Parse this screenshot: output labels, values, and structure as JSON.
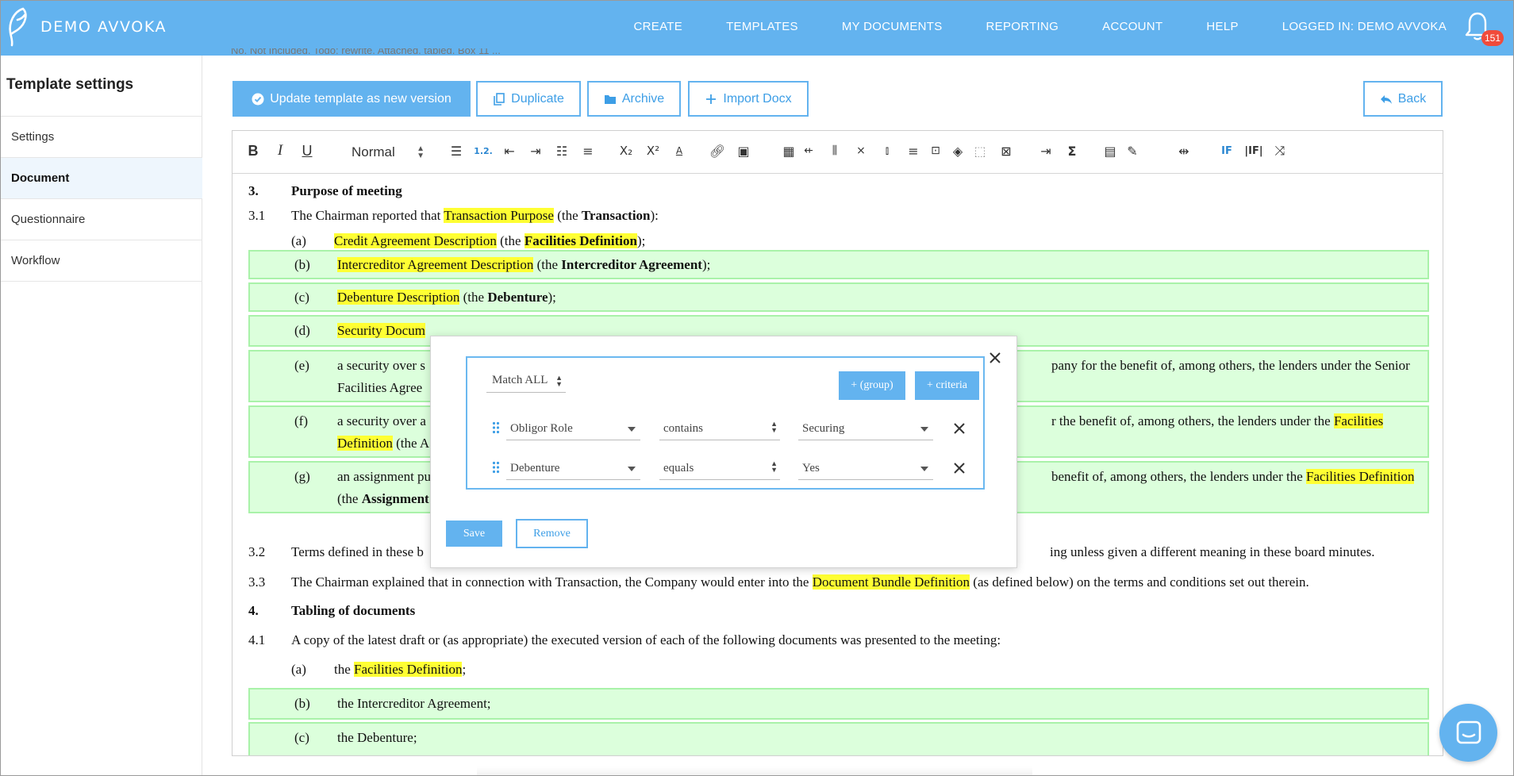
{
  "header": {
    "brand": "DEMO AVVOKA",
    "nav": [
      "CREATE",
      "TEMPLATES",
      "MY DOCUMENTS",
      "REPORTING",
      "ACCOUNT",
      "HELP",
      "LOGGED IN: DEMO AVVOKA"
    ],
    "notification_count": "151",
    "colors": {
      "bar": "#63b3ef",
      "badge": "#f04b3b"
    }
  },
  "sidebar": {
    "title": "Template settings",
    "items": [
      {
        "label": "Settings",
        "active": false
      },
      {
        "label": "Document",
        "active": true
      },
      {
        "label": "Questionnaire",
        "active": false
      },
      {
        "label": "Workflow",
        "active": false
      }
    ]
  },
  "actions": {
    "update": "Update template as new version",
    "duplicate": "Duplicate",
    "archive": "Archive",
    "import": "Import Docx",
    "back": "Back"
  },
  "toolbar": {
    "style_select": "Normal",
    "icons": [
      "bold-icon",
      "italic-icon",
      "underline-icon",
      "bullet-list-icon",
      "numbered-list-icon",
      "outdent-icon",
      "indent-icon",
      "checklist-icon",
      "align-left-icon",
      "subscript-icon",
      "superscript-icon",
      "text-color-icon",
      "link-icon",
      "image-icon",
      "table-icon",
      "insert-column-left-icon",
      "insert-column-right-icon",
      "delete-column-icon",
      "delete-row-icon",
      "align-icon",
      "merge-cells-icon",
      "fill-color-icon",
      "table-borders-icon",
      "crop-icon",
      "field-icon",
      "sum-icon",
      "calendar-icon",
      "signature-icon",
      "page-break-icon",
      "condition-if-icon",
      "condition-else-if-icon",
      "shuffle-icon"
    ]
  },
  "document": {
    "s3_num": "3.",
    "s3_title": "Purpose of meeting",
    "p31_num": "3.1",
    "p31_a": "The Chairman reported that ",
    "p31_b": "Transaction Purpose",
    "p31_c": " (the ",
    "p31_d": "Transaction",
    "p31_e": "):",
    "a_num": "(a)",
    "a_1": "Credit Agreement Description",
    "a_2": " (the ",
    "a_3": "Facilities Definition",
    "a_4": ");",
    "b_num": "(b)",
    "b_1": "Intercreditor Agreement Description",
    "b_2": " (the ",
    "b_3": "Intercreditor Agreement",
    "b_4": ");",
    "c_num": "(c)",
    "c_1": "Debenture Description",
    "c_2": " (the ",
    "c_3": "Debenture",
    "c_4": ");",
    "d_num": "(d)",
    "d_1": "Security Docum",
    "e_num": "(e)",
    "e_line1_left": "a security over s",
    "e_line1_right": "pany for the benefit of, among others, the lenders under the Senior",
    "e_line2": "Facilities Agree",
    "f_num": "(f)",
    "f_line1_left": "a security over a",
    "f_line1_right_a": "r the benefit of, among others, the lenders under the ",
    "f_line1_right_b": "Facilities ",
    "f_line2_a": "Definition",
    "f_line2_b": " (the A",
    "g_num": "(g)",
    "g_line1_left": "an assignment pu",
    "g_line1_right_a": "benefit of, among others, the lenders under the ",
    "g_line1_right_b": "Facilities Definition",
    "g_line2_a": "(the ",
    "g_line2_b": "Assignment",
    "p32_num": "3.2",
    "p32_left": "Terms defined in these b",
    "p32_right": "ing unless given a different meaning in these board minutes.",
    "p33_num": "3.3",
    "p33_a": "The Chairman explained that in connection with Transaction, the Company would enter into the ",
    "p33_b": "Document Bundle Definition",
    "p33_c": " (as defined below) on the terms and conditions set out therein.",
    "s4_num": "4.",
    "s4_title": "Tabling of documents",
    "p41_num": "4.1",
    "p41": "A copy of the latest draft or (as appropriate) the executed version of each of the following documents was presented to the meeting:",
    "t_a_num": "(a)",
    "t_a_1": "the ",
    "t_a_2": "Facilities Definition",
    "t_a_3": ";",
    "t_b_num": "(b)",
    "t_b": "the Intercreditor Agreement;",
    "t_c_num": "(c)",
    "t_c": "the Debenture;",
    "clipped_top": "No. Not Included. Todo: rewrite. Attached. tabled. Box 11 ..."
  },
  "modal": {
    "match": "Match ALL",
    "add_group": "+ (group)",
    "add_criteria": "+ criteria",
    "rows": [
      {
        "field": "Obligor Role",
        "operator": "contains",
        "value": "Securing"
      },
      {
        "field": "Debenture",
        "operator": "equals",
        "value": "Yes"
      }
    ],
    "save": "Save",
    "remove": "Remove"
  }
}
